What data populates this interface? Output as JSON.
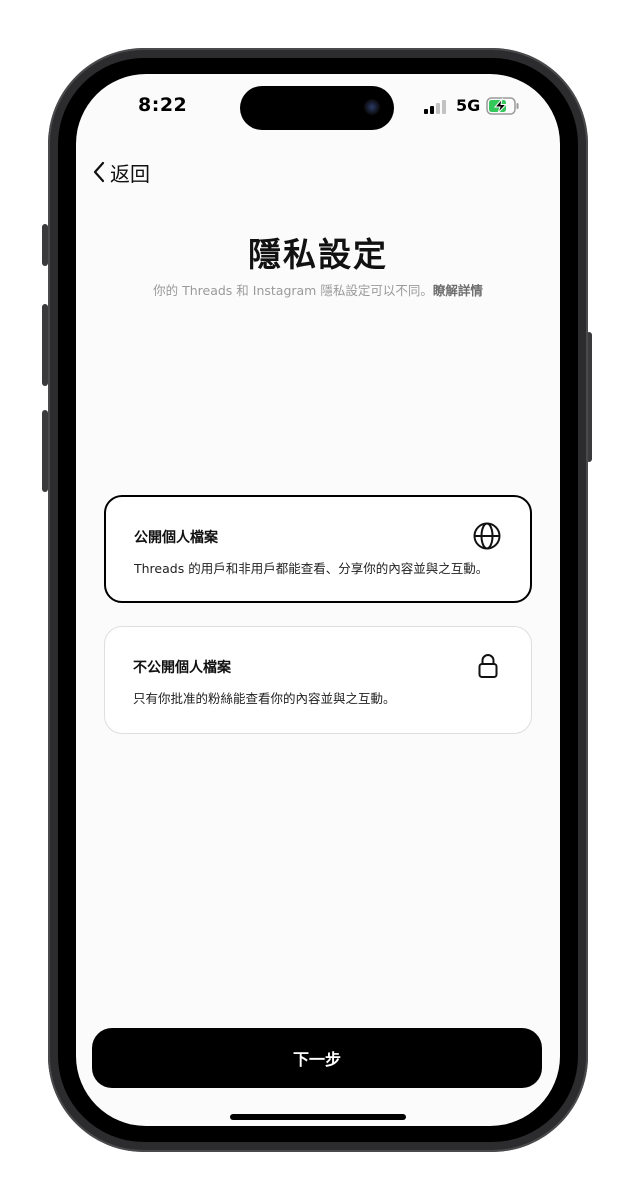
{
  "status_bar": {
    "time": "8:22",
    "network": "5G"
  },
  "nav": {
    "back_label": "返回"
  },
  "page": {
    "title": "隱私設定",
    "subtitle": "你的 Threads 和 Instagram 隱私設定可以不同。",
    "learn_more": "瞭解詳情"
  },
  "options": [
    {
      "title": "公開個人檔案",
      "description": "Threads 的用戶和非用戶都能查看、分享你的內容並與之互動。",
      "icon": "globe-icon",
      "selected": true
    },
    {
      "title": "不公開個人檔案",
      "description": "只有你批准的粉絲能查看你的內容並與之互動。",
      "icon": "lock-icon",
      "selected": false
    }
  ],
  "footer": {
    "next_label": "下一步"
  },
  "colors": {
    "primary": "#000000",
    "background": "#fbfbfb",
    "subtitle": "#9a9a9a",
    "battery_charge": "#34c759"
  }
}
